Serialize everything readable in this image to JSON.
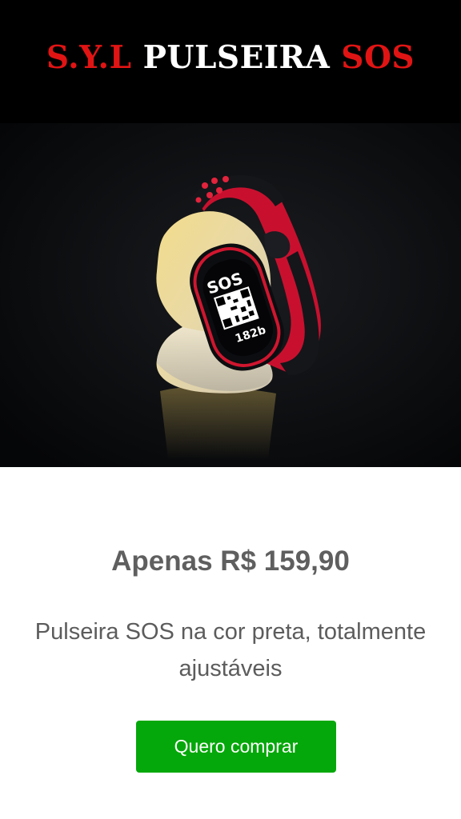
{
  "header": {
    "brand_part1": "S.Y.L",
    "brand_part2": "PULSEIRA",
    "brand_part3": "SOS",
    "colors": {
      "background": "#000000",
      "red": "#e11414",
      "white": "#ffffff"
    }
  },
  "hero": {
    "image_alt": "black and red SOS wristband with QR code on a stone",
    "band_text": "SOS",
    "band_code": "182b"
  },
  "product": {
    "price_text": "Apenas R$ 159,90",
    "description": "Pulseira SOS na cor preta, totalmente ajustáveis"
  },
  "cta": {
    "label": "Quero comprar",
    "color": "#05a80a"
  }
}
